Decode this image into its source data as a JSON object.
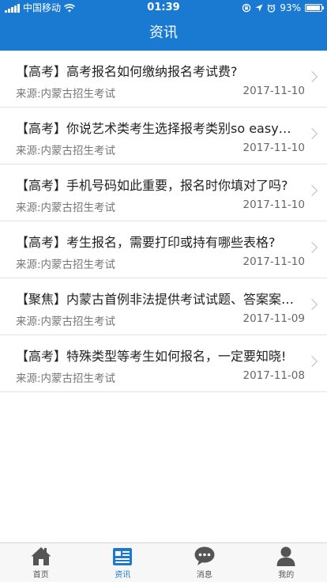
{
  "status": {
    "carrier": "中国移动",
    "time": "01:39",
    "battery": "93%",
    "battery_level": 0.93
  },
  "header": {
    "title": "资讯"
  },
  "news": [
    {
      "title": "【高考】高考报名如何缴纳报名考试费?",
      "source": "来源:内蒙古招生考试",
      "date": "2017-11-10"
    },
    {
      "title": "【高考】你说艺术类考生选择报考类别so easy，你真的以为自己选对了吗?",
      "source": "来源:内蒙古招生考试",
      "date": "2017-11-10"
    },
    {
      "title": "【高考】手机号码如此重要，报名时你填对了吗?",
      "source": "来源:内蒙古招生考试",
      "date": "2017-11-10"
    },
    {
      "title": "【高考】考生报名，需要打印或持有哪些表格?",
      "source": "来源:内蒙古招生考试",
      "date": "2017-11-10"
    },
    {
      "title": "【聚焦】内蒙古首例非法提供考试试题、答案案件宣判",
      "source": "来源:内蒙古招生考试",
      "date": "2017-11-09"
    },
    {
      "title": "【高考】特殊类型等考生如何报名，一定要知晓!",
      "source": "来源:内蒙古招生考试",
      "date": "2017-11-08"
    }
  ],
  "tabs": [
    {
      "label": "首页",
      "icon": "home-icon"
    },
    {
      "label": "资讯",
      "icon": "news-icon",
      "active": true
    },
    {
      "label": "消息",
      "icon": "chat-icon"
    },
    {
      "label": "我的",
      "icon": "user-icon"
    }
  ],
  "colors": {
    "brand": "#1a7ad2",
    "tab_inactive": "#555555"
  }
}
